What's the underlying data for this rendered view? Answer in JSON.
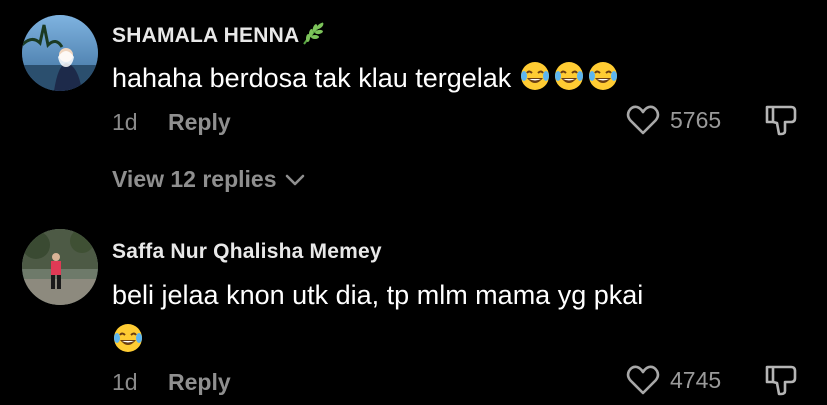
{
  "comments": [
    {
      "username": "SHAMALA HENNA",
      "username_emoji": "herb-emoji",
      "text": "hahaha berdosa tak klau tergelak",
      "text_emoji": "face-with-tears-of-joy",
      "text_emoji_count": 3,
      "time": "1d",
      "reply_label": "Reply",
      "like_count": "5765",
      "view_replies_label": "View 12 replies"
    },
    {
      "username": "Saffa Nur Qhalisha Memey",
      "text": "beli jelaa knon utk dia, tp mlm mama yg pkai",
      "text_emoji": "face-with-tears-of-joy",
      "text_emoji_count": 1,
      "time": "1d",
      "reply_label": "Reply",
      "like_count": "4745"
    }
  ],
  "icons": {
    "like": "heart-outline-icon",
    "dislike": "thumbs-down-icon",
    "expand": "chevron-down-icon"
  },
  "colors": {
    "background": "#000000",
    "primary_text": "#ffffff",
    "secondary_text": "#8f8f8f"
  }
}
